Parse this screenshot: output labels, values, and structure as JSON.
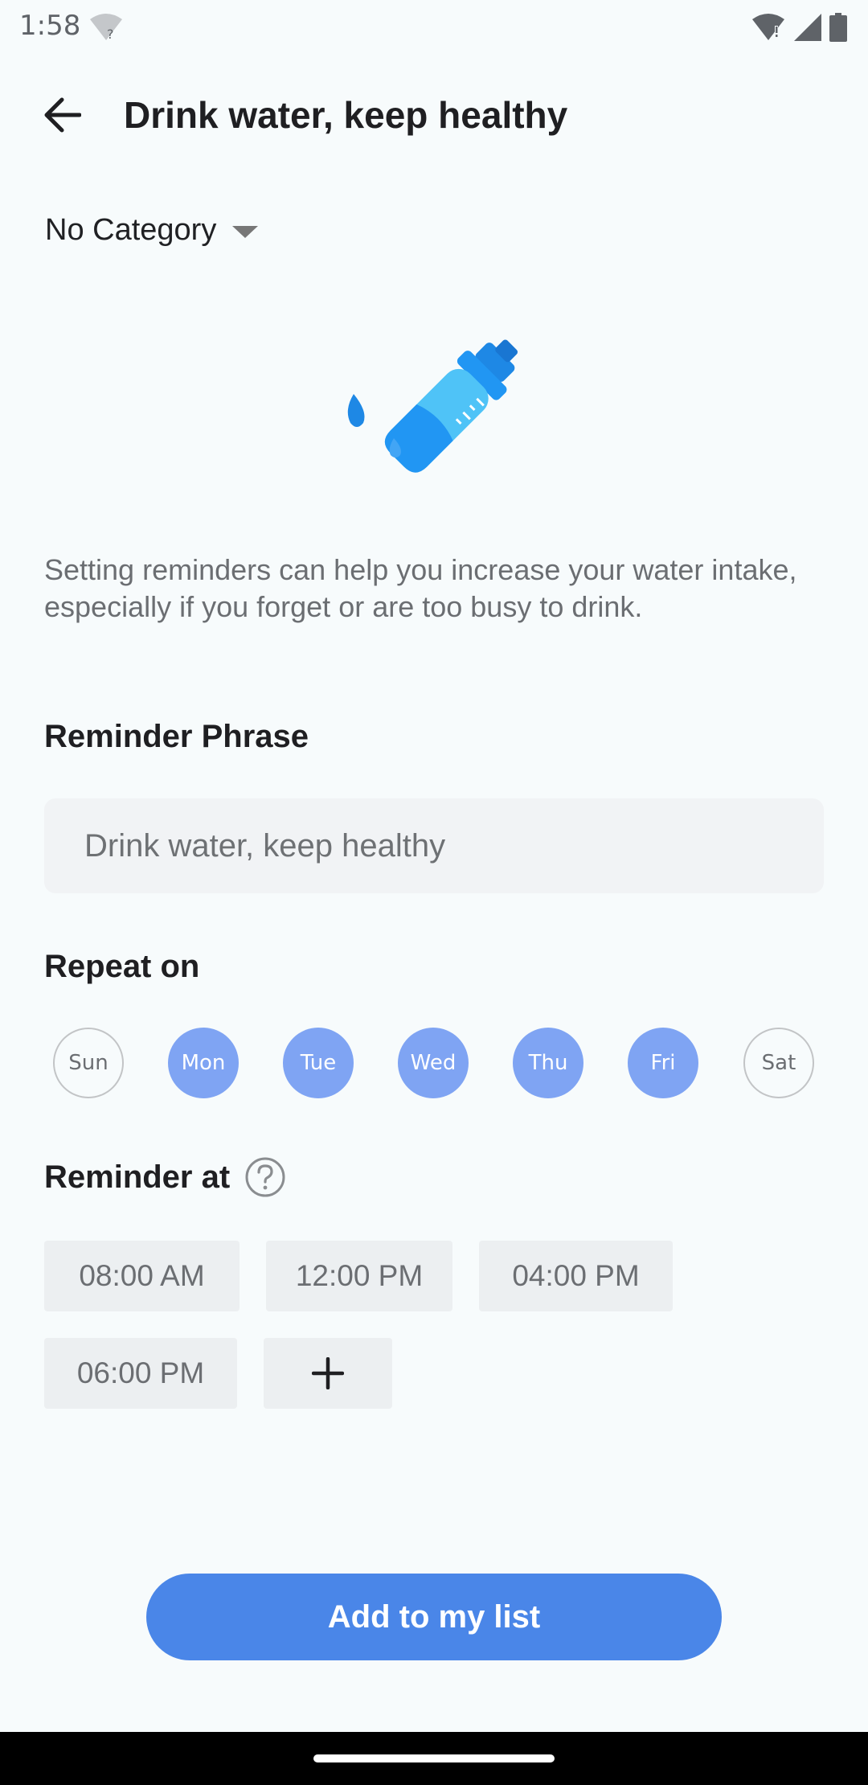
{
  "status_bar": {
    "time": "1:58"
  },
  "header": {
    "title": "Drink water, keep healthy"
  },
  "category": {
    "label": "No Category"
  },
  "description": "Setting reminders can help you increase your water intake, especially if you forget or are too busy to drink.",
  "reminder_phrase": {
    "heading": "Reminder Phrase",
    "value": "Drink water, keep healthy"
  },
  "repeat": {
    "heading": "Repeat on",
    "days": [
      {
        "label": "Sun",
        "selected": false
      },
      {
        "label": "Mon",
        "selected": true
      },
      {
        "label": "Tue",
        "selected": true
      },
      {
        "label": "Wed",
        "selected": true
      },
      {
        "label": "Thu",
        "selected": true
      },
      {
        "label": "Fri",
        "selected": true
      },
      {
        "label": "Sat",
        "selected": false
      }
    ]
  },
  "reminder_at": {
    "heading": "Reminder at",
    "times": [
      "08:00 AM",
      "12:00 PM",
      "04:00 PM",
      "06:00 PM"
    ]
  },
  "cta": {
    "label": "Add to my list"
  },
  "colors": {
    "accent": "#4a86e8",
    "day_selected": "#7fa4f3",
    "background": "#f7fbfc"
  },
  "icons": [
    "back-arrow-icon",
    "dropdown-caret-icon",
    "water-bottle-illustration",
    "help-icon",
    "plus-icon",
    "wifi-icon",
    "signal-icon",
    "battery-icon"
  ]
}
